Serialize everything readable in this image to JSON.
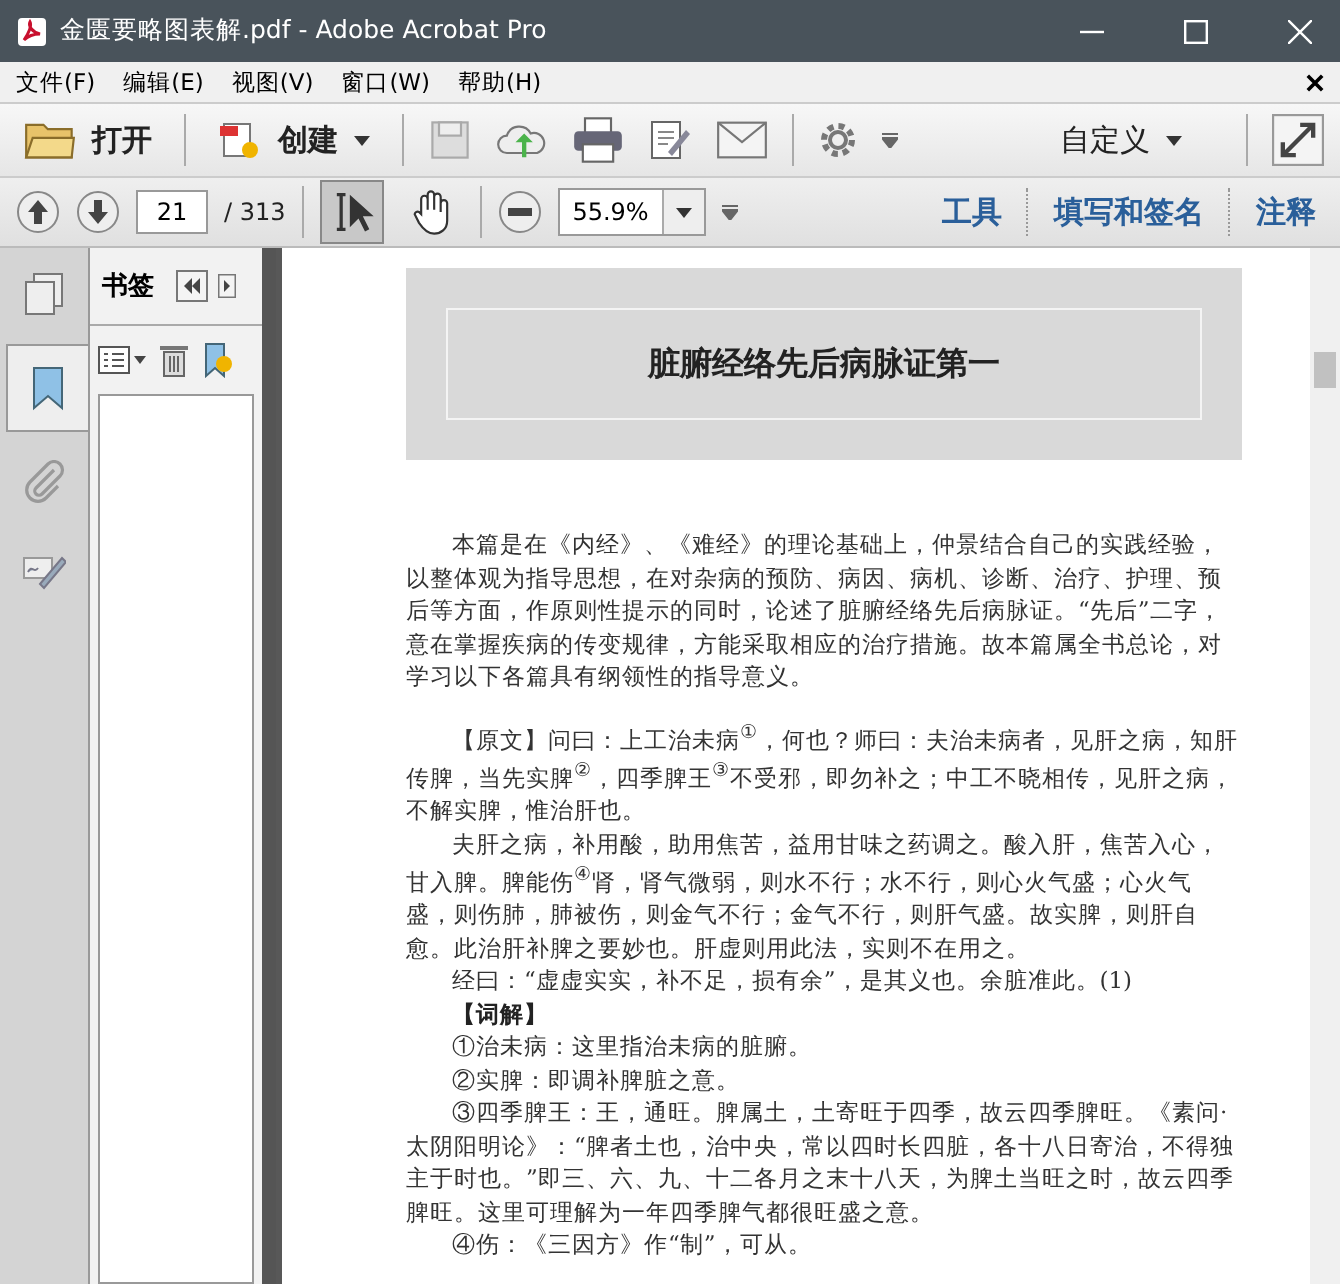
{
  "window": {
    "title": "金匮要略图表解.pdf - Adobe Acrobat Pro"
  },
  "menu": [
    "文件(F)",
    "编辑(E)",
    "视图(V)",
    "窗口(W)",
    "帮助(H)"
  ],
  "toolbar": {
    "open": "打开",
    "create": "创建",
    "customize": "自定义"
  },
  "navbar": {
    "page_number": "21",
    "page_total": "/ 313",
    "zoom": "55.9%",
    "tools": [
      {
        "kind": "select",
        "selected": true
      },
      {
        "kind": "hand",
        "selected": false
      }
    ],
    "links": [
      "工具",
      "填写和签名",
      "注释"
    ]
  },
  "sidebar": {
    "tabs": [
      {
        "kind": "pages",
        "selected": false
      },
      {
        "kind": "bookmarks",
        "selected": true
      },
      {
        "kind": "attachments",
        "selected": false
      },
      {
        "kind": "signatures",
        "selected": false
      }
    ],
    "panel_title": "书签"
  },
  "document": {
    "heading": "脏腑经络先后病脉证第一",
    "paragraphs": [
      {
        "kind": "body",
        "text": "本篇是在《内经》、《难经》的理论基础上，仲景结合自己的实践经验，以整体观为指导思想，在对杂病的预防、病因、病机、诊断、治疗、护理、预后等方面，作原则性提示的同时，论述了脏腑经络先后病脉证。“先后”二字，意在掌握疾病的传变规律，方能采取相应的治疗措施。故本篇属全书总论，对学习以下各篇具有纲领性的指导意义。"
      },
      {
        "kind": "body",
        "text": "【原文】问曰：上工治未病$^{①}$，何也？师曰：夫治未病者，见肝之病，知肝传脾，当先实脾$^{②}$，四季脾王$^{③}$不受邪，即勿补之；中工不晓相传，见肝之病，不解实脾，惟治肝也。"
      },
      {
        "kind": "body",
        "text": "夫肝之病，补用酸，助用焦苦，益用甘味之药调之。酸入肝，焦苦入心，甘入脾。脾能伤$^{④}$肾，肾气微弱，则水不行；水不行，则心火气盛；心火气盛，则伤肺，肺被伤，则金气不行；金气不行，则肝气盛。故实脾，则肝自愈。此治肝补脾之要妙也。肝虚则用此法，实则不在用之。"
      },
      {
        "kind": "body",
        "text": "经曰：“虚虚实实，补不足，损有余”，是其义也。余脏准此。(1)"
      },
      {
        "kind": "label",
        "text": "【词解】"
      },
      {
        "kind": "body",
        "text": "①治未病：这里指治未病的脏腑。"
      },
      {
        "kind": "body",
        "text": "②实脾：即调补脾脏之意。"
      },
      {
        "kind": "body",
        "text": "③四季脾王：王，通旺。脾属土，土寄旺于四季，故云四季脾旺。《素问·太阴阳明论》：“脾者土也，治中央，常以四时长四脏，各十八日寄治，不得独主于时也。”即三、六、九、十二各月之末十八天，为脾土当旺之时，故云四季脾旺。这里可理解为一年四季脾气都很旺盛之意。"
      },
      {
        "kind": "body",
        "text": "④伤：《三因方》作“制”，可从。"
      }
    ]
  }
}
